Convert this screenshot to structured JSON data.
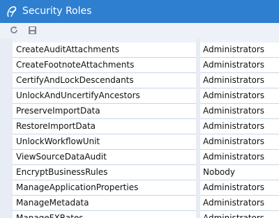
{
  "window": {
    "title": "Security Roles",
    "accent_color": "#2f7fd1",
    "logo_icon": "app-logo-icon"
  },
  "toolbar": {
    "refresh_icon": "refresh-icon",
    "save_icon": "save-icon"
  },
  "grid": {
    "rows": [
      {
        "name": "CreateAuditAttachments",
        "role": "Administrators"
      },
      {
        "name": "CreateFootnoteAttachments",
        "role": "Administrators"
      },
      {
        "name": "CertifyAndLockDescendants",
        "role": "Administrators"
      },
      {
        "name": "UnlockAndUncertifyAncestors",
        "role": "Administrators"
      },
      {
        "name": "PreserveImportData",
        "role": "Administrators"
      },
      {
        "name": "RestoreImportData",
        "role": "Administrators"
      },
      {
        "name": "UnlockWorkflowUnit",
        "role": "Administrators"
      },
      {
        "name": "ViewSourceDataAudit",
        "role": "Administrators"
      },
      {
        "name": "EncryptBusinessRules",
        "role": "Nobody"
      },
      {
        "name": "ManageApplicationProperties",
        "role": "Administrators"
      },
      {
        "name": "ManageMetadata",
        "role": "Administrators"
      },
      {
        "name": "ManageFXRates",
        "role": "Administrators"
      }
    ]
  }
}
